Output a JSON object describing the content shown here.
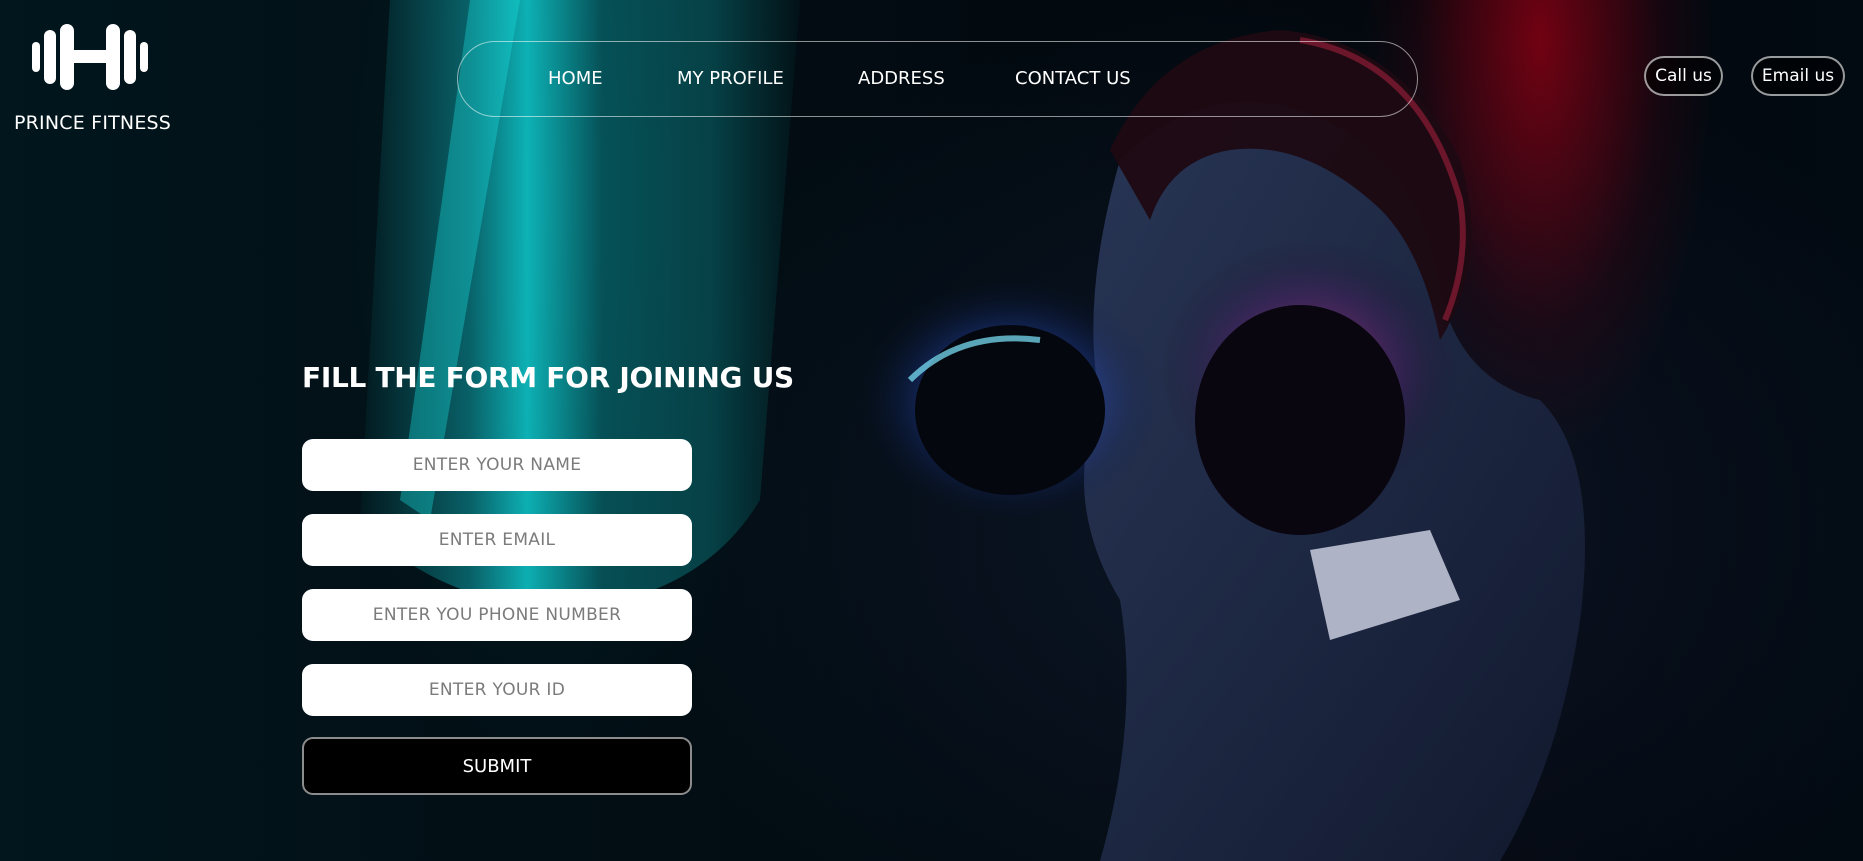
{
  "brand": {
    "name": "PRINCE FITNESS",
    "logo_icon": "dumbbell-icon"
  },
  "nav": {
    "items": [
      "HOME",
      "MY PROFILE",
      "ADDRESS",
      "CONTACT US"
    ]
  },
  "actions": {
    "call_label": "Call us",
    "email_label": "Email us"
  },
  "form": {
    "title": "FILL THE FORM FOR JOINING US",
    "name_placeholder": "ENTER YOUR NAME",
    "email_placeholder": "ENTER EMAIL",
    "phone_placeholder": "ENTER YOU PHONE NUMBER",
    "id_placeholder": "ENTER YOUR ID",
    "submit_label": "SUBMIT"
  },
  "colors": {
    "background": "#02080d",
    "accent_teal": "#00c8c8",
    "accent_red": "#9a0014",
    "input_bg": "#ffffff"
  }
}
